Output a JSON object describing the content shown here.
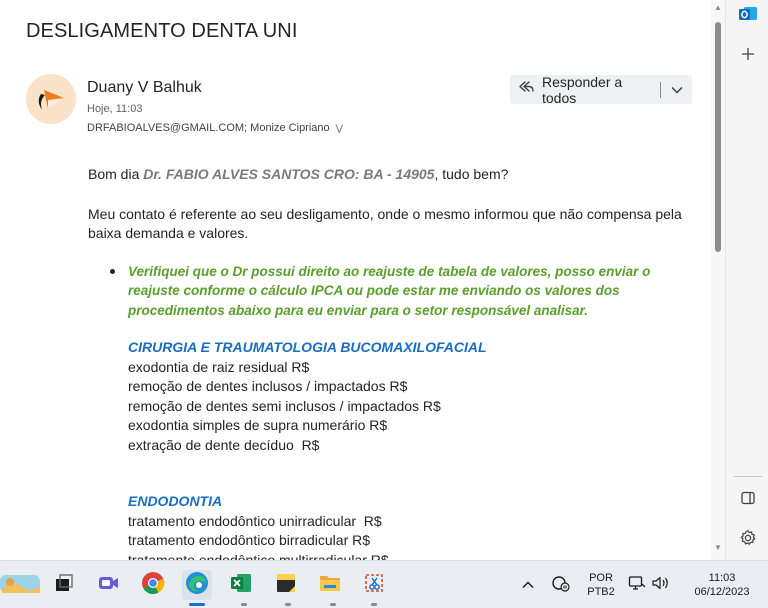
{
  "email": {
    "subject": "DESLIGAMENTO DENTA UNI",
    "sender": "Duany V Balhuk",
    "date": "Hoje, 11:03",
    "recipients": "DRFABIOALVES@GMAIL.COM; Monize Cipriano",
    "reply_all_label": "Responder a todos"
  },
  "body": {
    "greeting_prefix": "Bom dia ",
    "greeting_name": "Dr. FABIO ALVES SANTOS CRO: BA - 14905",
    "greeting_suffix": ", tudo bem?",
    "para1": "Meu contato é referente ao seu desligamento, onde o mesmo informou que não compensa pela baixa demanda e valores.",
    "bullet": "Verifiquei que o Dr possui direito ao reajuste de tabela de valores, posso enviar o reajuste conforme o cálculo IPCA ou pode estar me enviando os valores dos procedimentos abaixo para eu enviar para o setor responsável analisar.",
    "section1_title": "CIRURGIA E TRAUMATOLOGIA BUCOMAXILOFACIAL",
    "section1_items": [
      "exodontia de raiz residual R$",
      "remoção de dentes inclusos / impactados R$",
      "remoção de dentes semi inclusos / impactados R$",
      "exodontia simples de supra numerário R$",
      "extração de dente decíduo  R$"
    ],
    "section2_title": "ENDODONTIA",
    "section2_items": [
      "tratamento endodôntico unirradicular  R$",
      "tratamento endodôntico birradicular R$",
      "tratamento endodôntico multirradicular R$"
    ]
  },
  "taskbar": {
    "lang_top": "POR",
    "lang_bottom": "PTB2",
    "time": "11:03",
    "date": "06/12/2023"
  },
  "colors": {
    "accent_blue": "#1b6dbf",
    "green_text": "#5a9e2c",
    "outlook_blue": "#0f6cbd"
  },
  "icons": [
    "outlook-icon",
    "plus-icon",
    "panel-icon",
    "settings-icon",
    "reply-all-icon",
    "chevron-down-icon"
  ]
}
